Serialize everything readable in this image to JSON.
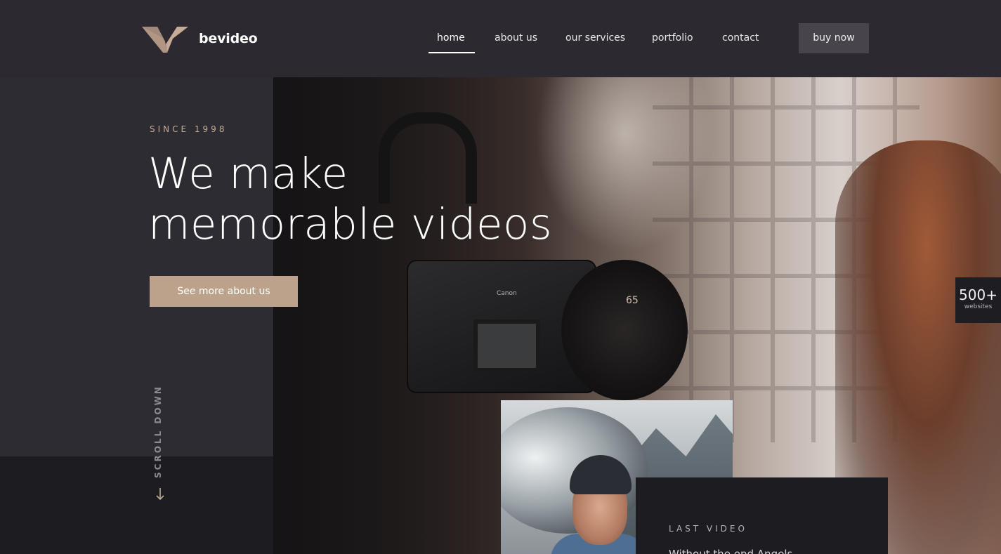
{
  "brand": {
    "name": "bevideo",
    "accent": "#bca18b"
  },
  "nav": {
    "items": [
      {
        "label": "home",
        "active": true
      },
      {
        "label": "about us",
        "active": false
      },
      {
        "label": "our services",
        "active": false
      },
      {
        "label": "portfolio",
        "active": false
      },
      {
        "label": "contact",
        "active": false
      }
    ],
    "cta_label": "buy now"
  },
  "hero": {
    "eyebrow": "SINCE 1998",
    "headline_line1": "We make",
    "headline_line2": "memorable videos",
    "button_label": "See more about us",
    "camera_brand": "Canon",
    "lens_marking": "65"
  },
  "scroll": {
    "label": "SCROLL DOWN",
    "icon": "arrow-down-icon"
  },
  "badge": {
    "number": "500+",
    "label": "websites"
  },
  "last_video": {
    "label": "LAST VIDEO",
    "title": "Without the end Angels"
  },
  "colors": {
    "header_bg": "#2c2a30",
    "panel_dark": "#1d1c20",
    "button_bg": "#47454b"
  }
}
